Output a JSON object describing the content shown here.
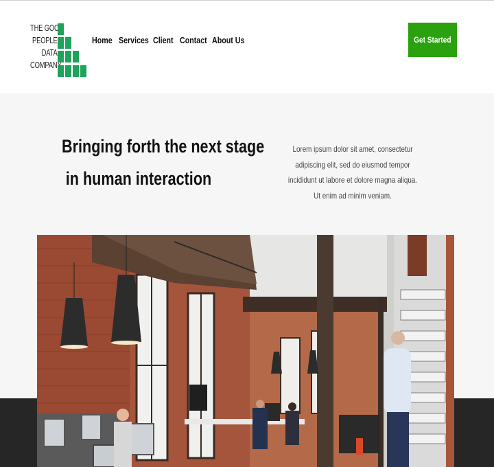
{
  "logo": {
    "lines": [
      "THE GOOD",
      "PEOPLE",
      "DATA",
      "COMPANY"
    ],
    "icon": "green-bar-blocks-icon",
    "accent": "#1ea35b"
  },
  "nav": {
    "items": [
      "Home",
      "Services",
      "Client",
      "Contact",
      "About Us"
    ]
  },
  "header": {
    "cta_label": "Get Started",
    "cta_color": "#2aa10f"
  },
  "hero": {
    "headline_line1": "Bringing forth the next stage",
    "headline_line2": "in human interaction",
    "lede": "Lorem ipsum dolor sit amet, consectetur adipiscing elit, sed do eiusmod tempor incididunt ut labore et dolore magna aliqua. Ut enim ad minim veniam."
  },
  "colors": {
    "hero_background": "#f6f6f6",
    "dark_band": "#262626"
  }
}
